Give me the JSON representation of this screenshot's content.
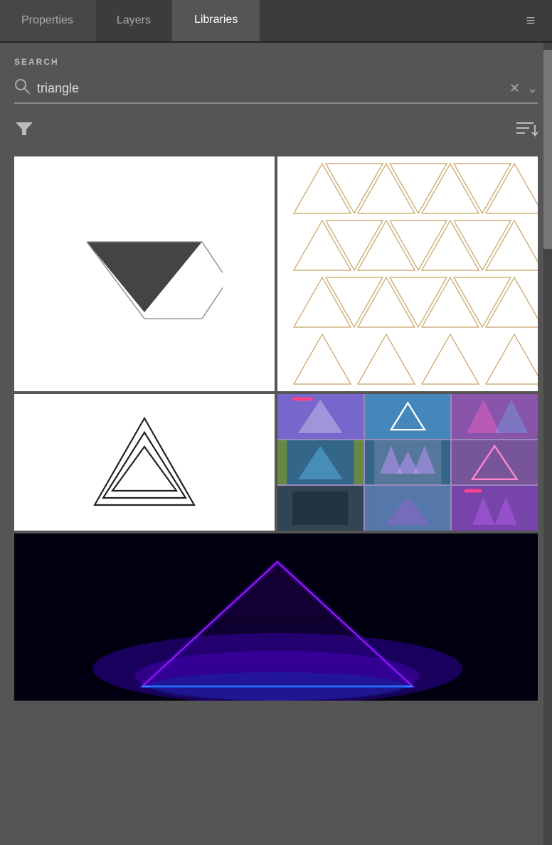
{
  "tabs": [
    {
      "id": "properties",
      "label": "Properties",
      "active": false
    },
    {
      "id": "layers",
      "label": "Layers",
      "active": false
    },
    {
      "id": "libraries",
      "label": "Libraries",
      "active": true
    }
  ],
  "menu_icon": "≡",
  "search_section": {
    "label": "SEARCH",
    "placeholder": "triangle",
    "value": "triangle",
    "clear_icon": "✕",
    "chevron_icon": "⌄"
  },
  "filter": {
    "filter_icon": "▼",
    "sort_icon": "≡↓"
  },
  "results": [
    {
      "id": "result-1",
      "alt": "Dark inverted triangle logo on white"
    },
    {
      "id": "result-2",
      "alt": "Gold outline triangle pattern on white"
    },
    {
      "id": "result-3",
      "alt": "Triple outline mountain triangle on white"
    },
    {
      "id": "result-4",
      "alt": "Triangle presentation template collage"
    },
    {
      "id": "result-5",
      "alt": "Neon glowing triangle on dark background"
    }
  ]
}
